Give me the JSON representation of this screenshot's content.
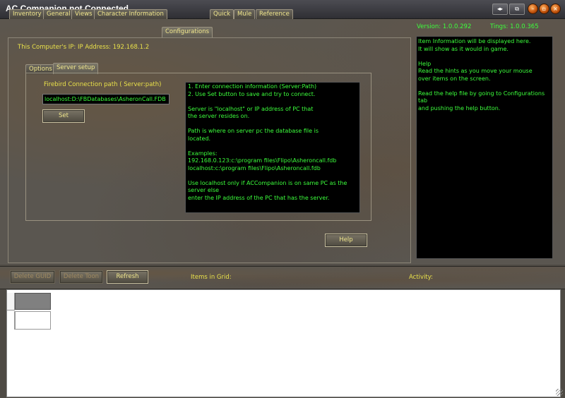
{
  "window": {
    "title": "AC Companion not Connected"
  },
  "tabs": [
    {
      "label": "Inventory"
    },
    {
      "label": "General"
    },
    {
      "label": "Views"
    },
    {
      "label": "Character Information"
    },
    {
      "label": "Configurations"
    },
    {
      "label": "Quick"
    },
    {
      "label": "Mule"
    },
    {
      "label": "Reference"
    }
  ],
  "active_tab": "Configurations",
  "config": {
    "ip_label": "This Computer's IP: IP Address: 192.168.1.2",
    "subtabs": [
      {
        "label": "Options"
      },
      {
        "label": "Server setup"
      }
    ],
    "active_subtab": "Server setup",
    "firebird_label": "Firebird Connection path ( Server:path)",
    "connection_value": "localhost:D:\\FBDatabases\\AsheronCall.FDB",
    "set_label": "Set",
    "help_label": "Help",
    "hints": "1. Enter connection information (Server:Path)\n2. Use Set button to save and try to connect.\n\nServer is \"localhost\" or IP address of PC that\nthe server resides on.\n\nPath is where on server pc the database file is\nlocated.\n\nExamples:\n192.168.0.123:c:\\program files\\Flipo\\Asheroncall.fdb\nlocalhost:c:\\program files\\Flipo\\Asheroncall.fdb\n\nUse localhost only if ACCompanion is on same PC as the\nserver else\nenter the IP address of the PC that has the server."
  },
  "info": {
    "version": "Version: 1.0.0.292",
    "tings": "Tings: 1.0.0.365",
    "item_info": "Item Information will be displayed here.\nIt will show as it would in game.\n\nHelp\n   Read the hints as you move your mouse\n   over items on the screen.\n\n   Read the help file by going to Configurations\ntab\n   and pushing the help button."
  },
  "toolbar": {
    "delete_guid": "Delete GUID",
    "delete_toon": "Delete Toon",
    "refresh": "Refresh",
    "items_in_grid": "Items in Grid:",
    "activity": "Activity:"
  },
  "colors": {
    "accent_text": "#e8e04a",
    "console_text": "#3cff3c",
    "console_bg": "#000000"
  }
}
